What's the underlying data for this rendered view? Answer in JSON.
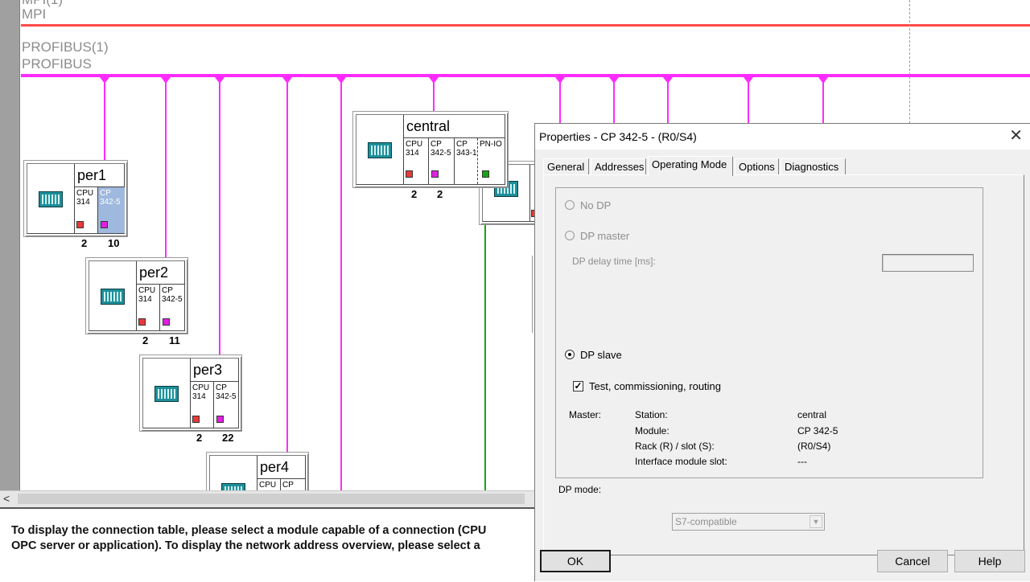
{
  "network": {
    "mpi_name": "MPI(1)",
    "mpi_label": "MPI",
    "profibus_name": "PROFIBUS(1)",
    "profibus_label": "PROFIBUS",
    "colors": {
      "mpi": "#ff4a4a",
      "profibus": "#ff2bff",
      "ethernet": "#16a316"
    },
    "stations": [
      {
        "name": "central",
        "modules": [
          "CPU\n314",
          "CP\n342-5",
          "CP\n343-1",
          "PN-IO"
        ],
        "addresses": [
          "2",
          "2"
        ]
      },
      {
        "name": "per1",
        "modules": [
          "CPU\n314",
          "CP\n342-5"
        ],
        "addresses": [
          "2",
          "10"
        ]
      },
      {
        "name": "per2",
        "modules": [
          "CPU\n314",
          "CP\n342-5"
        ],
        "addresses": [
          "2",
          "11"
        ]
      },
      {
        "name": "per3",
        "modules": [
          "CPU\n314",
          "CP\n342-5"
        ],
        "addresses": [
          "2",
          "22"
        ]
      },
      {
        "name": "per4",
        "modules": [
          "CPU",
          "CP"
        ],
        "addresses": []
      }
    ]
  },
  "scrollbar": {
    "left_arrow": "<"
  },
  "status": {
    "line1": "To display the connection table, please select a module capable of a connection (CPU",
    "line2": "OPC server or application). To display the network address overview, please select a"
  },
  "dialog": {
    "title": "Properties - CP 342-5 - (R0/S4)",
    "tabs": [
      "General",
      "Addresses",
      "Operating Mode",
      "Options",
      "Diagnostics"
    ],
    "active_tab": "Operating Mode",
    "no_dp": "No DP",
    "dp_master": "DP master",
    "dp_delay": "DP delay time [ms]:",
    "dp_delay_value": "",
    "dp_slave": "DP slave",
    "selected_mode": "DP slave",
    "test_label": "Test, commissioning, routing",
    "test_checked": true,
    "master_label": "Master:",
    "master_fields": [
      {
        "label": "Station:",
        "value": "central"
      },
      {
        "label": "Module:",
        "value": "CP 342-5"
      },
      {
        "label": "Rack (R) / slot (S):",
        "value": "(R0/S4)"
      },
      {
        "label": "Interface module slot:",
        "value": "---"
      }
    ],
    "dp_mode_label": "DP mode:",
    "dp_mode_value": "S7-compatible",
    "ok": "OK",
    "cancel": "Cancel",
    "help": "Help"
  }
}
